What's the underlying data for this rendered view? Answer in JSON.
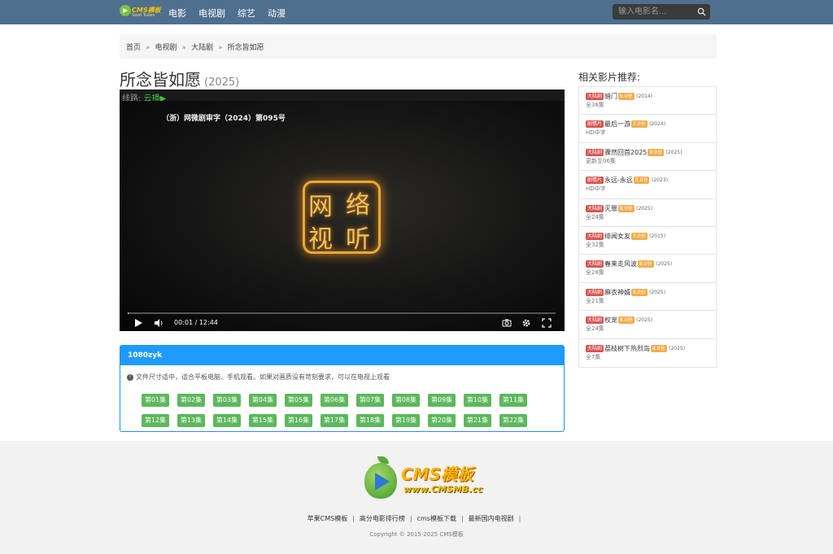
{
  "header": {
    "logo_text": "CMS模板",
    "logo_sub": "Swat Tubes",
    "nav": [
      "电影",
      "电视剧",
      "综艺",
      "动漫"
    ],
    "search_placeholder": "输入电影名..."
  },
  "breadcrumb": [
    "首页",
    "电视剧",
    "大陆剧",
    "所念皆如愿"
  ],
  "title": {
    "name": "所念皆如愿",
    "year": "(2025)"
  },
  "player": {
    "line_label": "线路:",
    "line_value": "云播▶",
    "license": "（浙）网微剧审字（2024）第095号",
    "seal_chars": [
      "网",
      "络",
      "视",
      "听"
    ],
    "time": "00:01 / 12:44",
    "progress": 0.0013
  },
  "episodes": {
    "source": "1080zyk",
    "tip": "文件尺寸适中，适合平板电脑、手机观看。如果对画质没有苛刻要求，可以在电视上观看",
    "list": [
      "第01集",
      "第02集",
      "第03集",
      "第04集",
      "第05集",
      "第06集",
      "第07集",
      "第08集",
      "第09集",
      "第10集",
      "第11集",
      "第12集",
      "第13集",
      "第14集",
      "第15集",
      "第16集",
      "第17集",
      "第18集",
      "第19集",
      "第20集",
      "第21集",
      "第22集"
    ]
  },
  "sidebar": {
    "title": "相关影片推荐:",
    "items": [
      {
        "cat": "大陆剧",
        "name": "暗门",
        "score": "9.0分",
        "year": "(2014)",
        "status": "全38集"
      },
      {
        "cat": "剧情片",
        "name": "最后一游",
        "score": "7.0分",
        "year": "(2024)",
        "status": "HD中字"
      },
      {
        "cat": "大陆剧",
        "name": "骤然回首2025",
        "score": "9.9分",
        "year": "(2025)",
        "status": "更新至06集"
      },
      {
        "cat": "剧情片",
        "name": "永远-永远",
        "score": "5.0分",
        "year": "(2023)",
        "status": "HD中字"
      },
      {
        "cat": "大陆剧",
        "name": "灭罪",
        "score": "8.0分",
        "year": "(2025)",
        "status": "全24集"
      },
      {
        "cat": "大陆剧",
        "name": "绯闻女友",
        "score": "3.0分",
        "year": "(2015)",
        "status": "全32集"
      },
      {
        "cat": "大陆剧",
        "name": "春来走风波",
        "score": "8.0分",
        "year": "(2025)",
        "status": "全28集"
      },
      {
        "cat": "大陆剧",
        "name": "麻衣神婿",
        "score": "8.0分",
        "year": "(2025)",
        "status": "全21集"
      },
      {
        "cat": "大陆剧",
        "name": "权宠",
        "score": "8.0分",
        "year": "(2025)",
        "status": "全24集"
      },
      {
        "cat": "大陆剧",
        "name": "荔枝树下热烈岛",
        "score": "8.0分",
        "year": "(2025)",
        "status": "全7集"
      }
    ]
  },
  "footer": {
    "brand": "CMS模板",
    "url": "www.CMSMB.cc",
    "links": [
      "苹果CMS模板",
      "高分电影排行榜",
      "cms模板下载",
      "最新国内电视剧"
    ],
    "copyright": "Copyright © 2015-2025 CMS模板"
  },
  "colors": {
    "header_bg": "#4f6f8f",
    "episode_btn": "#5cb85c",
    "episode_head": "#1e9bff",
    "cat_badge": "#d9534f",
    "score_badge": "#f0ad4e"
  }
}
